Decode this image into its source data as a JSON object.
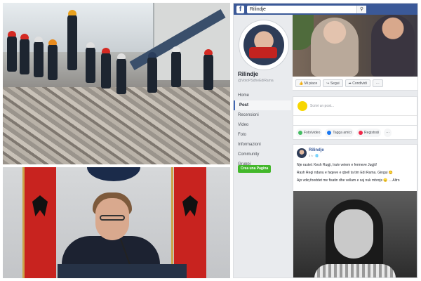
{
  "facebook": {
    "topbar": {
      "logo": "f",
      "search_value": "Rilindje",
      "search_icon": "search-icon"
    },
    "page": {
      "name": "Rilindje",
      "handle": "@VotoPSdheEdiRama"
    },
    "nav": [
      {
        "label": "Home",
        "active": false
      },
      {
        "label": "Post",
        "active": true
      },
      {
        "label": "Recensioni",
        "active": false
      },
      {
        "label": "Video",
        "active": false
      },
      {
        "label": "Foto",
        "active": false
      },
      {
        "label": "Informazioni",
        "active": false
      },
      {
        "label": "Community",
        "active": false
      },
      {
        "label": "Gruppi",
        "active": false
      }
    ],
    "create_page_label": "Crea una Pagina",
    "actions": {
      "like": "Mi piace",
      "follow": "Segui",
      "share": "Condividi",
      "more": "···"
    },
    "composer": {
      "placeholder": "Scrivi un post..."
    },
    "post_actions": [
      {
        "label": "Foto/video",
        "color": "#45bd62"
      },
      {
        "label": "Tagga amici",
        "color": "#1877f2"
      },
      {
        "label": "Registrati",
        "color": "#f02849"
      },
      {
        "label": "···",
        "color": "#90949c"
      }
    ],
    "post": {
      "author": "Rilindje",
      "time": "3 h · ",
      "line1": "Nje rastet: Kesh Rugji, Ira/e vetem e fermeve Jugjit!",
      "line2": "Rash Regi ndanu e faqeve e qbell ta tim Edi Rama. Gingui 😊",
      "line3": "Ajo vdiq fooddet me fisatin dhe vellam e saj nuk mbrojs 😞 ... Altro"
    }
  },
  "colors": {
    "fb_blue": "#3b5998",
    "create_green": "#42b72a",
    "flag_red": "#c8231f"
  }
}
